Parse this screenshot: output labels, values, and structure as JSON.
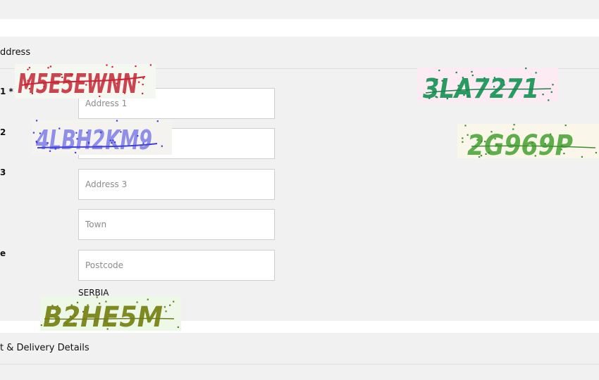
{
  "section_address": {
    "title": "ddress"
  },
  "form": {
    "labels": [
      "1 *",
      "2",
      "3",
      "e"
    ],
    "fields": [
      {
        "placeholder": "Address 1",
        "value": ""
      },
      {
        "placeholder": "",
        "value": ""
      },
      {
        "placeholder": "Address 3",
        "value": ""
      },
      {
        "placeholder": "Town",
        "value": ""
      },
      {
        "placeholder": "Postcode",
        "value": ""
      }
    ],
    "country": "SERBIA"
  },
  "section_delivery": {
    "title": "t & Delivery Details"
  },
  "captchas": [
    {
      "text": "M5E5EWNN",
      "bg": "#f4f8f1",
      "ink": "#c9454f",
      "noise": "#d12030"
    },
    {
      "text": "4LBH2KM9",
      "bg": "#f4f3ef",
      "ink": "#8f8ee8",
      "noise": "#3f3fe0"
    },
    {
      "text": "B2HE5M",
      "bg": "#eef8e9",
      "ink": "#7f8a22",
      "noise": "#6f7a1c"
    },
    {
      "text": "3LA7271",
      "bg": "#fcebf3",
      "ink": "#279b62",
      "noise": "#1f7f4f"
    },
    {
      "text": "2G969P",
      "bg": "#fbf6ea",
      "ink": "#5fae4b",
      "noise": "#3f8f33"
    }
  ]
}
